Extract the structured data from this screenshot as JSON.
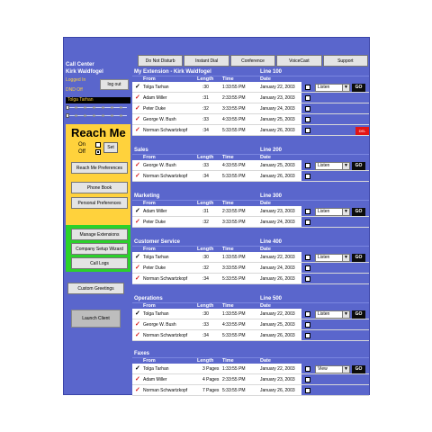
{
  "sidebar": {
    "title": "Call Center",
    "user": "Kirk Waldfogel",
    "status_logged": "Logged In",
    "status_dnd": "DND Off",
    "logout_label": "log out",
    "caller": "Tolga Tarhan",
    "reachme": {
      "title": "Reach Me",
      "on_label": "On",
      "off_label": "Off",
      "set_label": "Set",
      "selected": "Off"
    },
    "buttons": {
      "reach_me_prefs": "Reach Me Preferences",
      "phone_book": "Phone Book",
      "personal_prefs": "Personal Preferences",
      "manage_ext": "Manage Extensions",
      "company_wizard": "Company Setup Wizard",
      "call_logs": "Call Logs",
      "custom_greetings": "Custom Greetings",
      "launch_client": "Launch Client"
    }
  },
  "toolbar": {
    "do_not_disturb": "Do Not Disturb",
    "instant_dial": "Instant Dial",
    "conference": "Conference",
    "voicecast": "VoiceCast",
    "support": "Support"
  },
  "columns": {
    "from": "From",
    "length": "Length",
    "time": "Time",
    "date": "Date"
  },
  "panels": [
    {
      "title": "My Extension - Kirk Waldfogel",
      "line": "Line 100",
      "action": "Listen",
      "go": "GO",
      "rows": [
        {
          "from": "Tolga Tarhan",
          "length": ":30",
          "time": "1:33:55 PM",
          "date": "January 22, 2003"
        },
        {
          "from": "Adam Miller",
          "length": ":31",
          "time": "2:33:55 PM",
          "date": "January 23, 2003"
        },
        {
          "from": "Peter Duke",
          "length": ":32",
          "time": "3:33:55 PM",
          "date": "January 24, 2003"
        },
        {
          "from": "George W. Bush",
          "length": ":33",
          "time": "4:33:55 PM",
          "date": "January 25, 2003"
        },
        {
          "from": "Norman Schwartzkopf",
          "length": ":34",
          "time": "5:33:55 PM",
          "date": "January 26, 2003"
        }
      ],
      "flag": "DEL"
    },
    {
      "title": "Sales",
      "line": "Line 200",
      "action": "Listen",
      "go": "GO",
      "rows": [
        {
          "from": "George W. Bush",
          "length": ":33",
          "time": "4:33:55 PM",
          "date": "January 25, 2003"
        },
        {
          "from": "Norman Schwartzkopf",
          "length": ":34",
          "time": "5:33:55 PM",
          "date": "January 26, 2003"
        }
      ]
    },
    {
      "title": "Marketing",
      "line": "Line 300",
      "action": "Listen",
      "go": "GO",
      "rows": [
        {
          "from": "Adam Miller",
          "length": ":31",
          "time": "2:33:55 PM",
          "date": "January 23, 2003"
        },
        {
          "from": "Peter Duke",
          "length": ":32",
          "time": "3:33:55 PM",
          "date": "January 24, 2003"
        }
      ]
    },
    {
      "title": "Customer Service",
      "line": "Line 400",
      "action": "Listen",
      "go": "GO",
      "rows": [
        {
          "from": "Tolga Tarhan",
          "length": ":30",
          "time": "1:33:55 PM",
          "date": "January 22, 2003"
        },
        {
          "from": "Peter Duke",
          "length": ":32",
          "time": "3:33:55 PM",
          "date": "January 24, 2003"
        },
        {
          "from": "Norman Schwartzkopf",
          "length": ":34",
          "time": "5:33:55 PM",
          "date": "January 26, 2003"
        }
      ]
    },
    {
      "title": "Operations",
      "line": "Line 500",
      "action": "Listen",
      "go": "GO",
      "rows": [
        {
          "from": "Tolga Tarhan",
          "length": ":30",
          "time": "1:33:55 PM",
          "date": "January 22, 2003"
        },
        {
          "from": "George W. Bush",
          "length": ":33",
          "time": "4:33:55 PM",
          "date": "January 25, 2003"
        },
        {
          "from": "Norman Schwartzkopf",
          "length": ":34",
          "time": "5:33:55 PM",
          "date": "January 26, 2003"
        }
      ]
    },
    {
      "title": "Faxes",
      "line": "",
      "action": "View",
      "go": "GO",
      "rows": [
        {
          "from": "Tolga Tarhan",
          "length": "3 Pages",
          "time": "1:33:55 PM",
          "date": "January 22, 2003"
        },
        {
          "from": "Adam Miller",
          "length": "4 Pages",
          "time": "2:33:55 PM",
          "date": "January 23, 2003"
        },
        {
          "from": "Norman Schwartzkopf",
          "length": "7 Pages",
          "time": "5:33:55 PM",
          "date": "January 26, 2003"
        }
      ]
    }
  ],
  "colors": {
    "app_bg": "#5a66cc",
    "reachme_bg": "#ffd23c",
    "admin_bg": "#2bd12b",
    "checkmark": "#d51a1a",
    "go_bg": "#0c0c0c"
  }
}
